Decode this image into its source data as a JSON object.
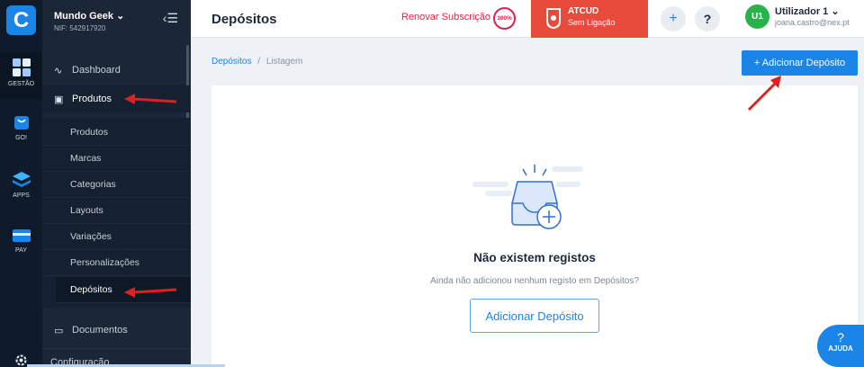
{
  "rail": {
    "logo": "C",
    "items": [
      {
        "label": "GESTÃO",
        "icon": "grid-icon"
      },
      {
        "label": "GO!",
        "icon": "shopping-bag-icon"
      },
      {
        "label": "APPS",
        "icon": "layers-icon"
      },
      {
        "label": "PAY",
        "icon": "credit-card-icon"
      }
    ]
  },
  "sidebar": {
    "org_name": "Mundo Geek",
    "org_nif": "NIF: 542917920",
    "menu": {
      "dashboard": "Dashboard",
      "produtos": "Produtos",
      "documentos": "Documentos",
      "configuracao": "Configuração"
    },
    "submenu": [
      "Produtos",
      "Marcas",
      "Categorias",
      "Layouts",
      "Variações",
      "Personalizações",
      "Depósitos"
    ]
  },
  "topbar": {
    "title": "Depósitos",
    "renew_label": "Renovar Subscrição",
    "renew_badge": "100%",
    "atcud_title": "ATCUD",
    "atcud_status": "Sem Ligação",
    "add_symbol": "+",
    "help_symbol": "?",
    "user_initials": "U1",
    "user_name": "Utilizador 1",
    "user_email": "joana.castro@nex.pt"
  },
  "breadcrumb": {
    "link": "Depósitos",
    "separator": "/",
    "current": "Listagem"
  },
  "actions": {
    "add_button": "+ Adicionar Depósito"
  },
  "empty_state": {
    "title": "Não existem registos",
    "subtitle": "Ainda não adicionou nenhum registo em Depósitos?",
    "button": "Adicionar Depósito"
  },
  "help": {
    "symbol": "?",
    "label": "AJUDA"
  },
  "colors": {
    "primary": "#1b84e7",
    "danger": "#e51f4b",
    "atcud": "#e74b3c",
    "sidebar": "#1b2636"
  }
}
